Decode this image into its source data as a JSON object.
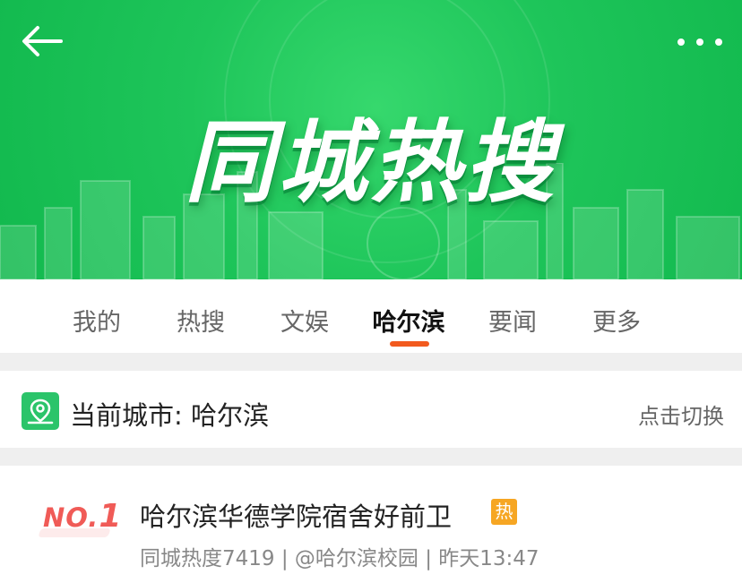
{
  "banner": {
    "title": "同城热搜",
    "back_icon": "arrow-left-icon",
    "more_icon": "more-dots-icon"
  },
  "tabs": [
    {
      "label": "我的",
      "active": false
    },
    {
      "label": "热搜",
      "active": false
    },
    {
      "label": "文娱",
      "active": false
    },
    {
      "label": "哈尔滨",
      "active": true
    },
    {
      "label": "要闻",
      "active": false
    },
    {
      "label": "更多",
      "active": false
    }
  ],
  "city": {
    "label": "当前城市: 哈尔滨",
    "switch_label": "点击切换",
    "icon": "map-pin-icon"
  },
  "list": [
    {
      "rank_prefix": "NO.",
      "rank": "1",
      "title": "哈尔滨华德学院宿舍好前卫",
      "badge": "热",
      "meta": "同城热度7419 | @哈尔滨校园 | 昨天13:47"
    }
  ],
  "colors": {
    "banner_green": "#1ec55a",
    "accent_orange": "#f25a1e",
    "rank_red": "#f05b57",
    "hot_badge": "#f6a623",
    "city_icon_green": "#2bc46a"
  }
}
